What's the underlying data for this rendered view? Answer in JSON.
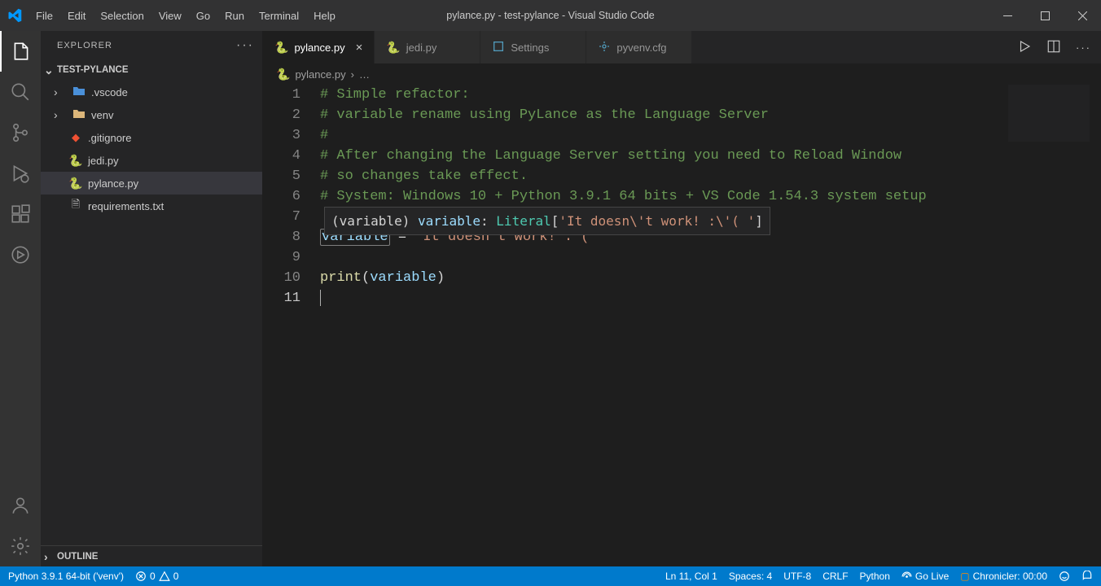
{
  "window": {
    "title": "pylance.py - test-pylance - Visual Studio Code"
  },
  "menubar": [
    "File",
    "Edit",
    "Selection",
    "View",
    "Go",
    "Run",
    "Terminal",
    "Help"
  ],
  "sidebar": {
    "header": "EXPLORER",
    "folder": "TEST-PYLANCE",
    "items": [
      {
        "label": ".vscode",
        "type": "folder",
        "chev": "›"
      },
      {
        "label": "venv",
        "type": "folder",
        "chev": "›"
      },
      {
        "label": ".gitignore",
        "type": "git"
      },
      {
        "label": "jedi.py",
        "type": "py"
      },
      {
        "label": "pylance.py",
        "type": "py",
        "active": true
      },
      {
        "label": "requirements.txt",
        "type": "txt"
      }
    ],
    "outline": "OUTLINE"
  },
  "tabs": [
    {
      "label": "pylance.py",
      "icon": "py",
      "active": true,
      "close": "×"
    },
    {
      "label": "jedi.py",
      "icon": "py"
    },
    {
      "label": "Settings",
      "icon": "settings"
    },
    {
      "label": "pyvenv.cfg",
      "icon": "gear"
    }
  ],
  "breadcrumb": {
    "file": "pylance.py",
    "sep": "›",
    "more": "…"
  },
  "editor": {
    "lines": [
      "1",
      "2",
      "3",
      "4",
      "5",
      "6",
      "7",
      "8",
      "9",
      "10",
      "11"
    ],
    "c1": "# Simple refactor:",
    "c2": "# variable rename using PyLance as the Language Server",
    "c3": "#",
    "c4": "# After changing the Language Server setting you need to Reload Window",
    "c5": "# so changes take effect.",
    "c6": "# System: Windows 10 + Python 3.9.1 64 bits + VS Code 1.54.3 system setup",
    "l8": {
      "var": "variable",
      "eq": " = ",
      "str": "\"It doesn't work! :'( \""
    },
    "l10": {
      "fn": "print",
      "op": "(",
      "arg": "variable",
      "cp": ")"
    },
    "hover": {
      "p1": "(variable) ",
      "name": "variable",
      "colon": ": ",
      "type": "Literal",
      "open": "[",
      "lit": "'It doesn\\'t work! :\\'( '",
      "close": "]"
    }
  },
  "status": {
    "python": "Python 3.9.1 64-bit ('venv')",
    "errors": "0",
    "warnings": "0",
    "lncol": "Ln 11, Col 1",
    "spaces": "Spaces: 4",
    "encoding": "UTF-8",
    "eol": "CRLF",
    "lang": "Python",
    "golive": "Go Live",
    "chronicler": "Chronicler: 00:00"
  }
}
